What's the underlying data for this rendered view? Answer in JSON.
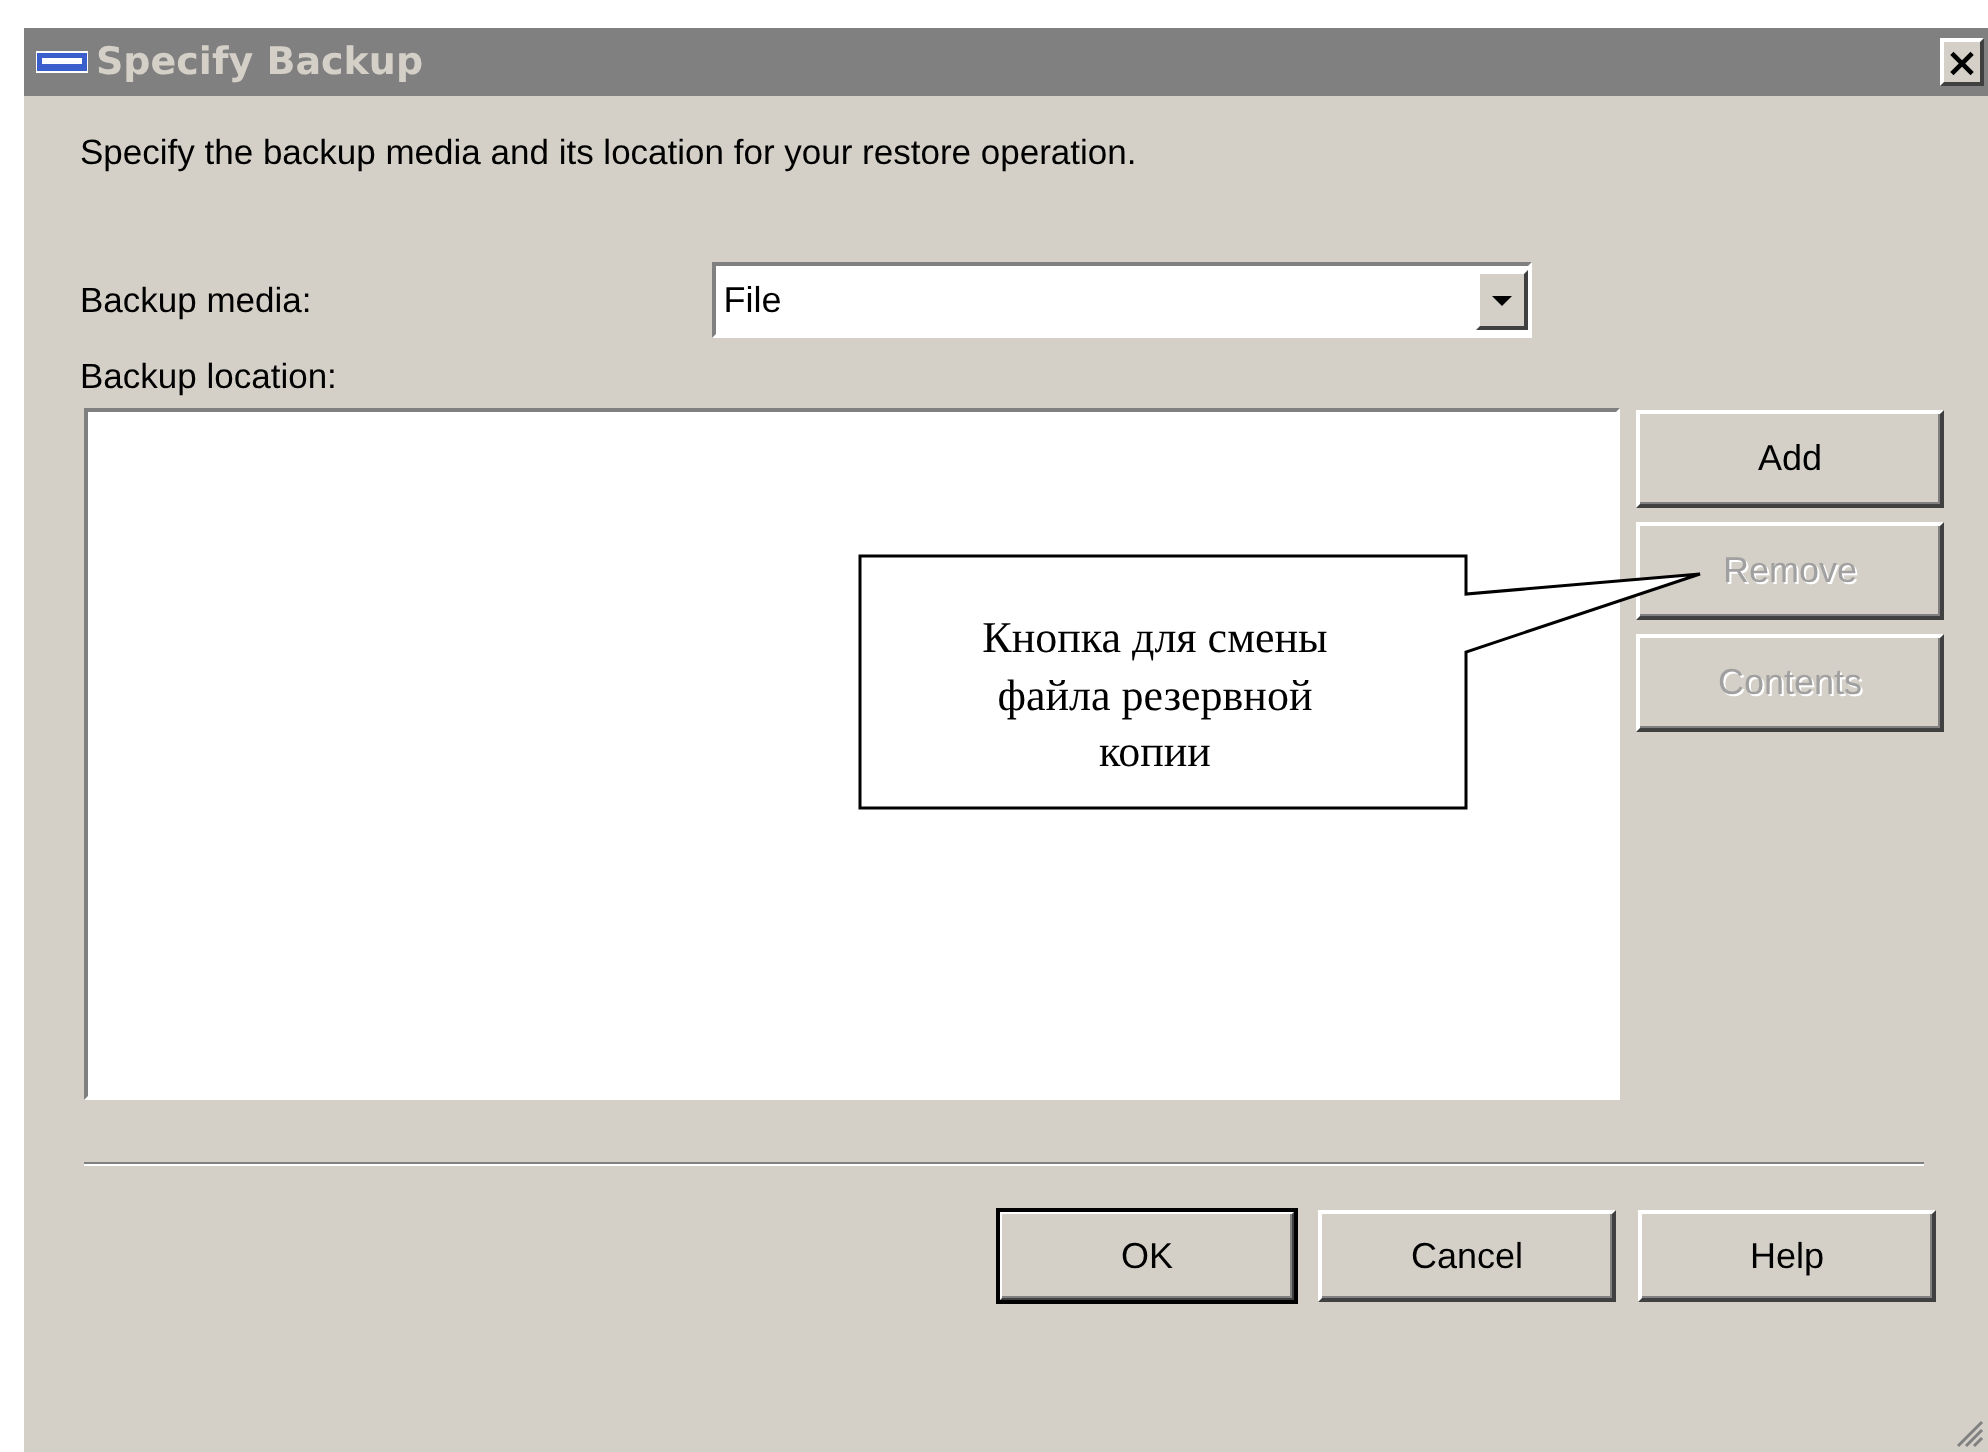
{
  "window": {
    "title": "Specify Backup",
    "close_button": "×"
  },
  "description": "Specify the backup media and its location for your restore operation.",
  "backup_media": {
    "label": "Backup media:",
    "value": "File"
  },
  "backup_location": {
    "label": "Backup location:"
  },
  "side_buttons": [
    {
      "label": "Add",
      "disabled": false
    },
    {
      "label": "Remove",
      "disabled": true
    },
    {
      "label": "Contents",
      "disabled": true
    }
  ],
  "dialog_buttons": [
    {
      "label": "OK",
      "default": true
    },
    {
      "label": "Cancel",
      "default": false
    },
    {
      "label": "Help",
      "default": false
    }
  ],
  "callout": {
    "text": "Кнопка для смены файла резервной копии"
  }
}
